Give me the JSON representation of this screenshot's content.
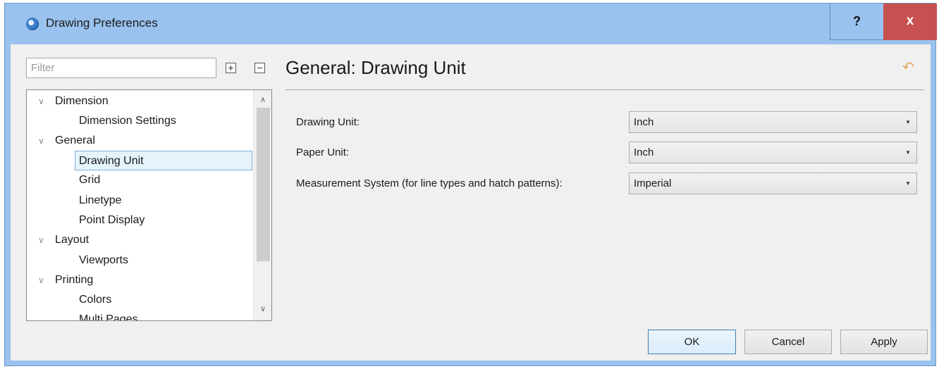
{
  "window": {
    "title": "Drawing Preferences",
    "help_label": "?",
    "close_label": "x",
    "accent_color": "#99c2ee",
    "close_color": "#c75050"
  },
  "filter": {
    "placeholder": "Filter",
    "value": "",
    "expand_all_icon": "expand-all-icon",
    "collapse_all_icon": "collapse-all-icon"
  },
  "tree": {
    "items": [
      {
        "label": "Dimension",
        "level": 0,
        "expanded": true
      },
      {
        "label": "Dimension Settings",
        "level": 1
      },
      {
        "label": "General",
        "level": 0,
        "expanded": true
      },
      {
        "label": "Drawing Unit",
        "level": 1,
        "selected": true
      },
      {
        "label": "Grid",
        "level": 1
      },
      {
        "label": "Linetype",
        "level": 1
      },
      {
        "label": "Point Display",
        "level": 1
      },
      {
        "label": "Layout",
        "level": 0,
        "expanded": true
      },
      {
        "label": "Viewports",
        "level": 1
      },
      {
        "label": "Printing",
        "level": 0,
        "expanded": true
      },
      {
        "label": "Colors",
        "level": 1
      },
      {
        "label": "Multi Pages",
        "level": 1
      }
    ]
  },
  "main": {
    "title": "General: Drawing Unit",
    "reset_icon": "undo-icon",
    "fields": [
      {
        "label": "Drawing Unit:",
        "value": "Inch"
      },
      {
        "label": "Paper Unit:",
        "value": "Inch"
      },
      {
        "label": "Measurement System (for line types and hatch patterns):",
        "value": "Imperial"
      }
    ]
  },
  "buttons": {
    "ok": "OK",
    "cancel": "Cancel",
    "apply": "Apply"
  }
}
